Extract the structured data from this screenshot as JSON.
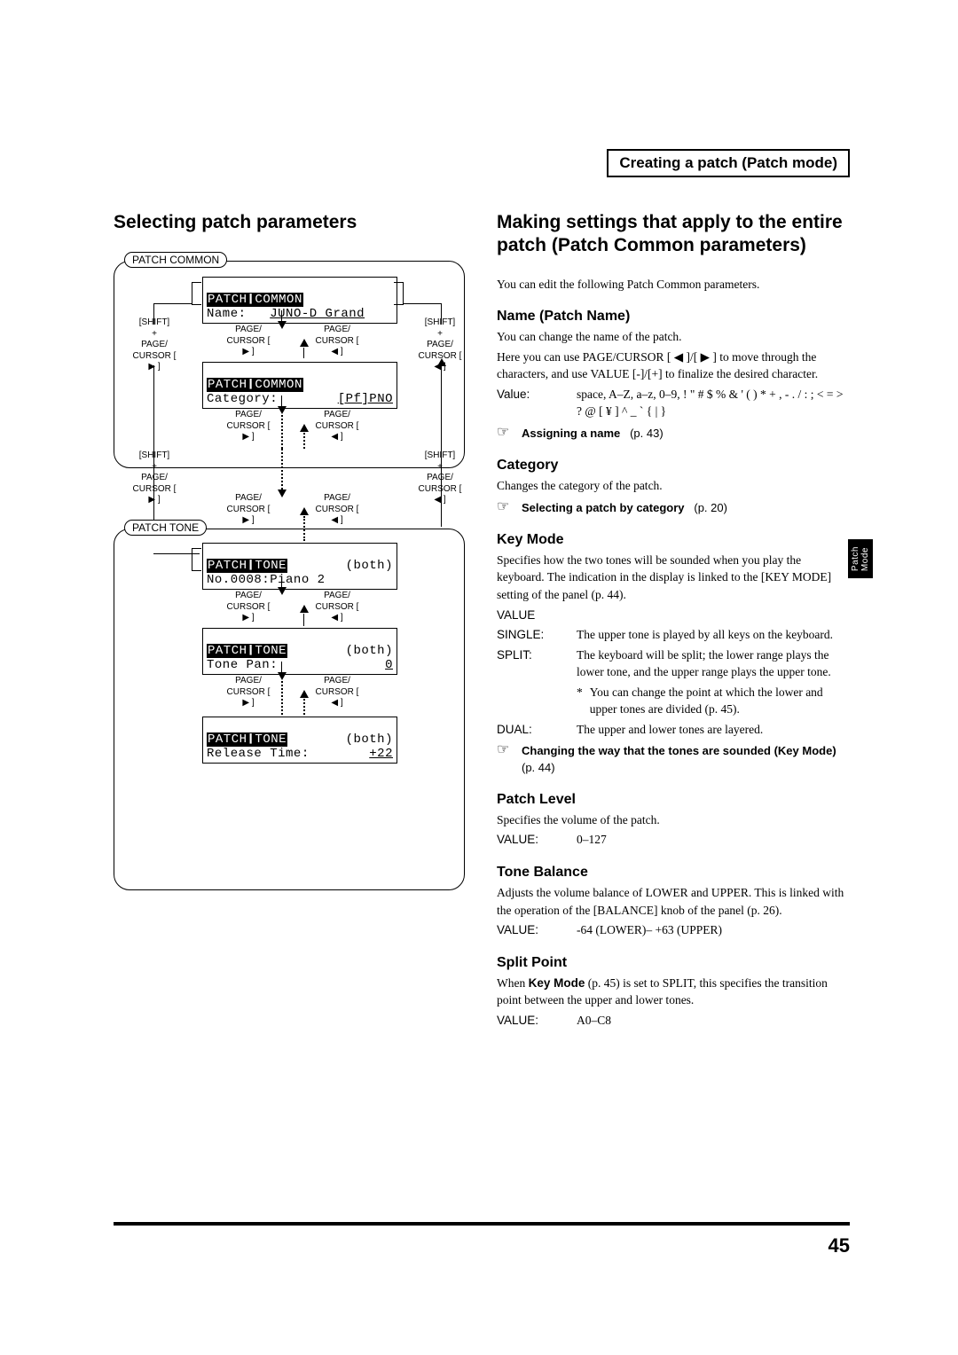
{
  "breadcrumb": "Creating a patch (Patch mode)",
  "side_tab": "Patch Mode",
  "page_number": "45",
  "left": {
    "heading": "Selecting patch parameters",
    "grp_common": "PATCH COMMON",
    "grp_tone": "PATCH TONE",
    "lcd1_l1": "PATCH❙COMMON",
    "lcd1_l2a": "Name:",
    "lcd1_l2b": "JUNO-D Grand",
    "lcd2_l1": "PATCH❙COMMON",
    "lcd2_l2a": "Category:",
    "lcd2_l2b": "[Pf]PNO",
    "lcd3_l1": "PATCH❙TONE",
    "lcd3_r1": "(both)",
    "lcd3_l2": "No.0008:Piano 2",
    "lcd4_l1": "PATCH❙TONE",
    "lcd4_r1": "(both)",
    "lcd4_l2a": "Tone Pan:",
    "lcd4_l2b": "0",
    "lcd5_l1": "PATCH❙TONE",
    "lcd5_r1": "(both)",
    "lcd5_l2a": "Release Time:",
    "lcd5_l2b": "+22",
    "shift": "[SHIFT]",
    "plus": "+",
    "page": "PAGE/",
    "cursor_r": "CURSOR [ ▶ ]",
    "cursor_l": "CURSOR [ ◀ ]"
  },
  "right": {
    "heading": "Making settings that apply to the entire patch (Patch Common parameters)",
    "intro": "You can edit the following Patch Common parameters.",
    "name": {
      "h": "Name (Patch Name)",
      "p1": "You can change the name of the patch.",
      "p2": "Here you can use PAGE/CURSOR [ ◀ ]/[ ▶ ] to move through the characters, and use VALUE [-]/[+] to finalize the desired character.",
      "val_label": "Value:",
      "val_text": "space, A–Z, a–z, 0–9, ! \" # $ % & ' ( ) * + , - . /  : ;  < = > ? @ [ ¥ ] ^ _ ` {  |  }",
      "ref": "Assigning a name",
      "ref_p": "(p. 43)"
    },
    "category": {
      "h": "Category",
      "p1": "Changes the category of the patch.",
      "ref": "Selecting a patch by category",
      "ref_p": "(p. 20)"
    },
    "keymode": {
      "h": "Key Mode",
      "p1": "Specifies how the two tones will be sounded when you play the keyboard. The indication in the display is linked to the [KEY MODE] setting of the panel (p. 44).",
      "value_label": "VALUE",
      "single_l": "SINGLE:",
      "single_t": "The upper tone is played by all keys on the keyboard.",
      "split_l": "SPLIT:",
      "split_t": "The keyboard will be split; the lower range plays the lower tone, and the upper range plays the upper tone.",
      "split_note": "You can change the point at which the lower and upper tones are divided (p. 45).",
      "dual_l": "DUAL:",
      "dual_t": "The upper and lower tones are layered.",
      "ref": "Changing the way that the tones are sounded (Key Mode)",
      "ref_p": "(p. 44)"
    },
    "patchlevel": {
      "h": "Patch Level",
      "p1": "Specifies the volume of the patch.",
      "val_label": "VALUE:",
      "val_text": "0–127"
    },
    "tonebalance": {
      "h": "Tone Balance",
      "p1": "Adjusts the volume balance of LOWER and UPPER. This is linked with the operation of the [BALANCE] knob of the panel (p. 26).",
      "val_label": "VALUE:",
      "val_text": "-64 (LOWER)– +63 (UPPER)"
    },
    "splitpoint": {
      "h": "Split Point",
      "p1_a": "When ",
      "p1_b": "Key Mode",
      "p1_c": " (p. 45) is set to SPLIT, this specifies the transition point between the upper and lower tones.",
      "val_label": "VALUE:",
      "val_text": "A0–C8"
    }
  }
}
